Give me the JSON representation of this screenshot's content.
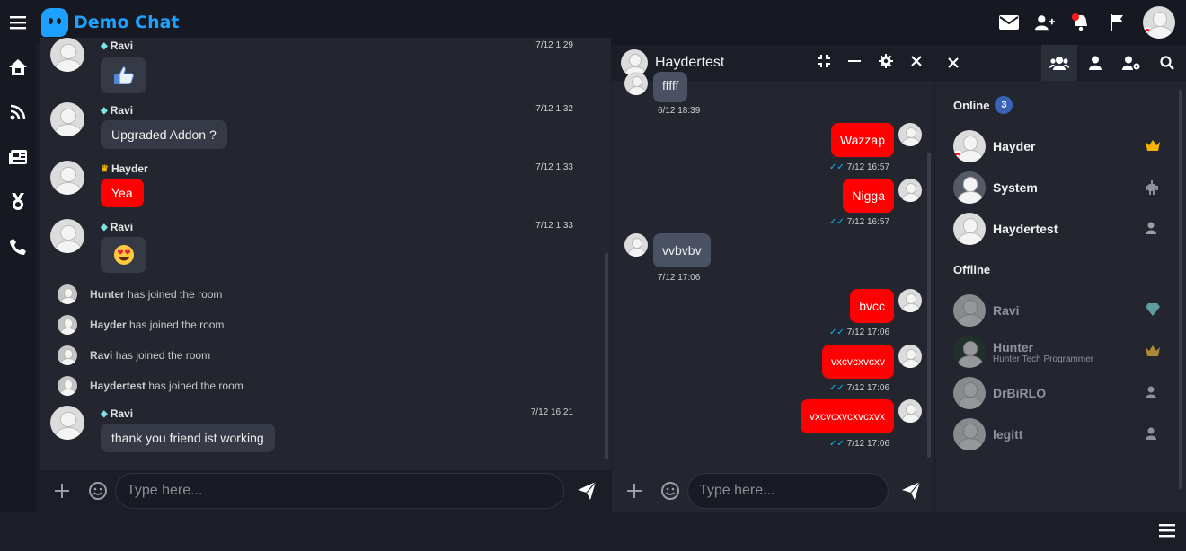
{
  "app": {
    "title": "Demo Chat",
    "brand_color": "#1ea0ff"
  },
  "topbar": {
    "icons": [
      "menu-icon",
      "envelope-icon",
      "user-plus-icon",
      "bell-icon",
      "flag-icon"
    ]
  },
  "leftnav": {
    "icons": [
      "home-icon",
      "rss-icon",
      "news-icon",
      "medal-icon",
      "phone-icon"
    ]
  },
  "main": {
    "messages": [
      {
        "user": "Ravi",
        "rank": "diamond",
        "time": "7/12 1:29",
        "text": "",
        "emoji": "thumbs-up"
      },
      {
        "user": "Ravi",
        "rank": "diamond",
        "time": "7/12 1:32",
        "text": "Upgraded Addon ?"
      },
      {
        "user": "Hayder",
        "rank": "crown",
        "time": "7/12 1:33",
        "text": "Yea"
      },
      {
        "user": "Ravi",
        "rank": "diamond",
        "time": "7/12 1:33",
        "text": "",
        "emoji": "heart-eyes"
      },
      {
        "user": "Ravi",
        "rank": "diamond",
        "time": "7/12 16:21",
        "text": "thank you friend ist working"
      }
    ],
    "joins": [
      {
        "user": "Hunter",
        "text": "has joined the room"
      },
      {
        "user": "Hayder",
        "text": "has joined the room"
      },
      {
        "user": "Ravi",
        "text": "has joined the room"
      },
      {
        "user": "Haydertest",
        "text": "has joined the room"
      }
    ],
    "input_placeholder": "Type here..."
  },
  "pm": {
    "title": "Haydertest",
    "messages": [
      {
        "side": "left",
        "text": "fffff",
        "time": "6/12 18:39"
      },
      {
        "side": "right",
        "text": "Wazzap",
        "time": "7/12 16:57"
      },
      {
        "side": "right",
        "text": "Nigga",
        "time": "7/12 16:57"
      },
      {
        "side": "left",
        "text": "vvbvbv",
        "time": "7/12 17:06"
      },
      {
        "side": "right",
        "text": "bvcc",
        "time": "7/12 17:06"
      },
      {
        "side": "right",
        "text": "vxcvcxvcxv",
        "time": "7/12 17:06"
      },
      {
        "side": "right",
        "text": "vxcvcxvcxvcxvx",
        "time": "7/12 17:06"
      }
    ],
    "input_placeholder": "Type here..."
  },
  "users": {
    "online_label": "Online",
    "online_count": "3",
    "offline_label": "Offline",
    "online": [
      {
        "name": "Hayder",
        "rank": "crown",
        "busy": true
      },
      {
        "name": "System",
        "rank": "robot"
      },
      {
        "name": "Haydertest",
        "rank": "user"
      }
    ],
    "offline": [
      {
        "name": "Ravi",
        "rank": "diamond"
      },
      {
        "name": "Hunter",
        "mood": "Hunter Tech Programmer",
        "rank": "crown"
      },
      {
        "name": "DrBiRLO",
        "rank": "user"
      },
      {
        "name": "legitt",
        "rank": "user"
      }
    ]
  }
}
